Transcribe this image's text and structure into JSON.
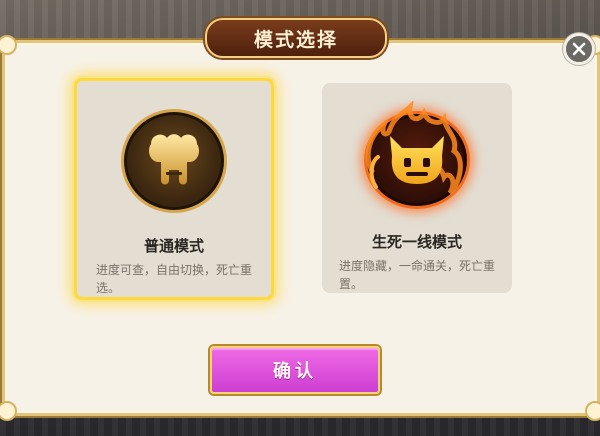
{
  "dialog": {
    "title": "模式选择",
    "close_icon": "close-icon"
  },
  "modes": [
    {
      "name": "普通模式",
      "description": "进度可查，自由切换，死亡重选。",
      "icon": "elephant-head-icon",
      "selected": true
    },
    {
      "name": "生死一线模式",
      "description": "进度隐藏，一命通关，死亡重置。",
      "icon": "flaming-devil-icon",
      "selected": false
    }
  ],
  "confirm": {
    "label": "确认"
  },
  "colors": {
    "selected_glow": "#ffd93b",
    "confirm_button": "#e056df",
    "title_plate": "#6a2f15"
  }
}
